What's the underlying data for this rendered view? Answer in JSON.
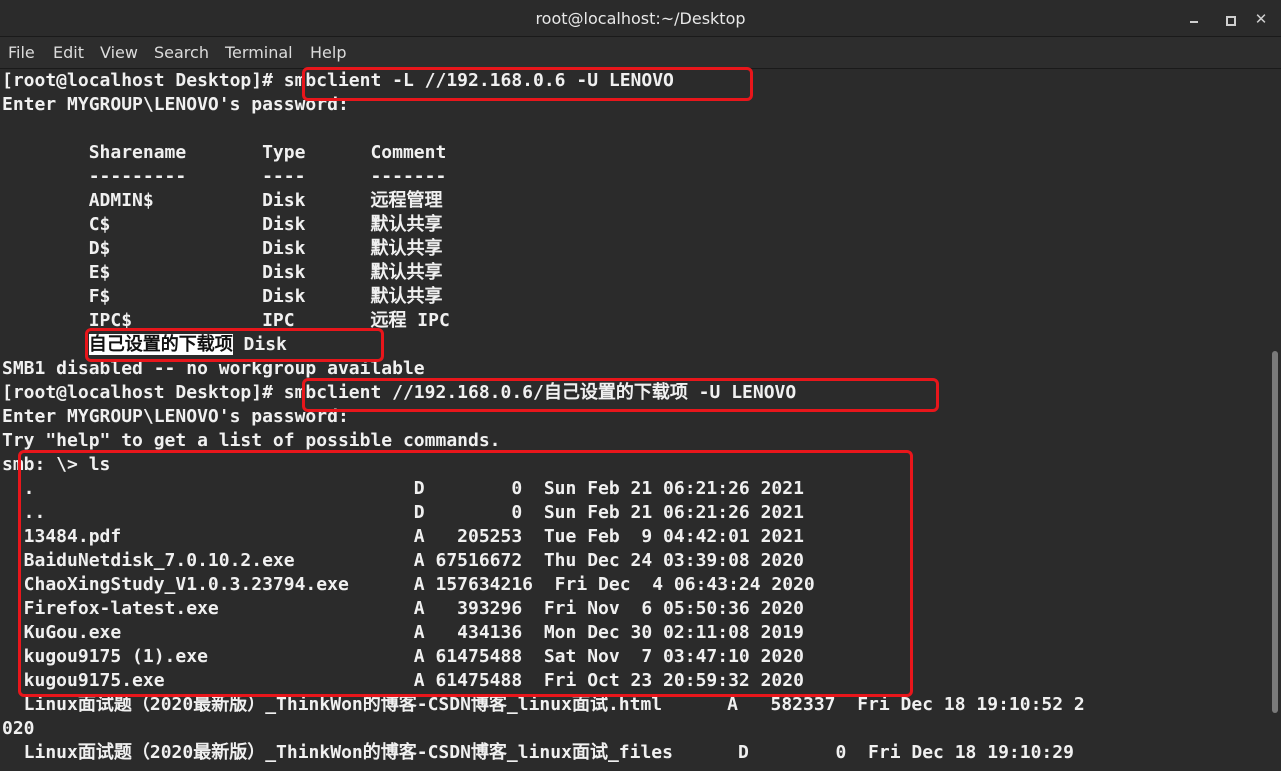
{
  "window": {
    "title": "root@localhost:~/Desktop"
  },
  "menu": [
    "File",
    "Edit",
    "View",
    "Search",
    "Terminal",
    "Help"
  ],
  "lines": [
    "[root@localhost Desktop]# smbclient -L //192.168.0.6 -U LENOVO",
    "Enter MYGROUP\\LENOVO's password:",
    "",
    "        Sharename       Type      Comment",
    "        ---------       ----      -------",
    "        ADMIN$          Disk      远程管理",
    "        C$              Disk      默认共享",
    "        D$              Disk      默认共享",
    "        E$              Disk      默认共享",
    "        F$              Disk      默认共享",
    "        IPC$            IPC       远程 IPC",
    "        自己设置的下载项 Disk",
    "SMB1 disabled -- no workgroup available",
    "[root@localhost Desktop]# smbclient //192.168.0.6/自己设置的下载项 -U LENOVO",
    "Enter MYGROUP\\LENOVO's password:",
    "Try \"help\" to get a list of possible commands.",
    "smb: \\> ls",
    "  .                                   D        0  Sun Feb 21 06:21:26 2021",
    "  ..                                  D        0  Sun Feb 21 06:21:26 2021",
    "  13484.pdf                           A   205253  Tue Feb  9 04:42:01 2021",
    "  BaiduNetdisk_7.0.10.2.exe           A 67516672  Thu Dec 24 03:39:08 2020",
    "  ChaoXingStudy_V1.0.3.23794.exe      A 157634216  Fri Dec  4 06:43:24 2020",
    "  Firefox-latest.exe                  A   393296  Fri Nov  6 05:50:36 2020",
    "  KuGou.exe                           A   434136  Mon Dec 30 02:11:08 2019",
    "  kugou9175 (1).exe                   A 61475488  Sat Nov  7 03:47:10 2020",
    "  kugou9175.exe                       A 61475488  Fri Oct 23 20:59:32 2020",
    "  Linux面试题（2020最新版）_ThinkWon的博客-CSDN博客_linux面试.html      A   582337  Fri Dec 18 19:10:52 2",
    "020",
    "  Linux面试题（2020最新版）_ThinkWon的博客-CSDN博客_linux面试_files      D        0  Fri Dec 18 19:10:29"
  ],
  "selection": {
    "prefix": "        ",
    "text": "自己设置的下载项",
    "suffix": " Disk"
  },
  "colors": {
    "terminal_bg": "#2b2b2b",
    "text": "#f0f0f0",
    "annotation": "#e8161b"
  }
}
